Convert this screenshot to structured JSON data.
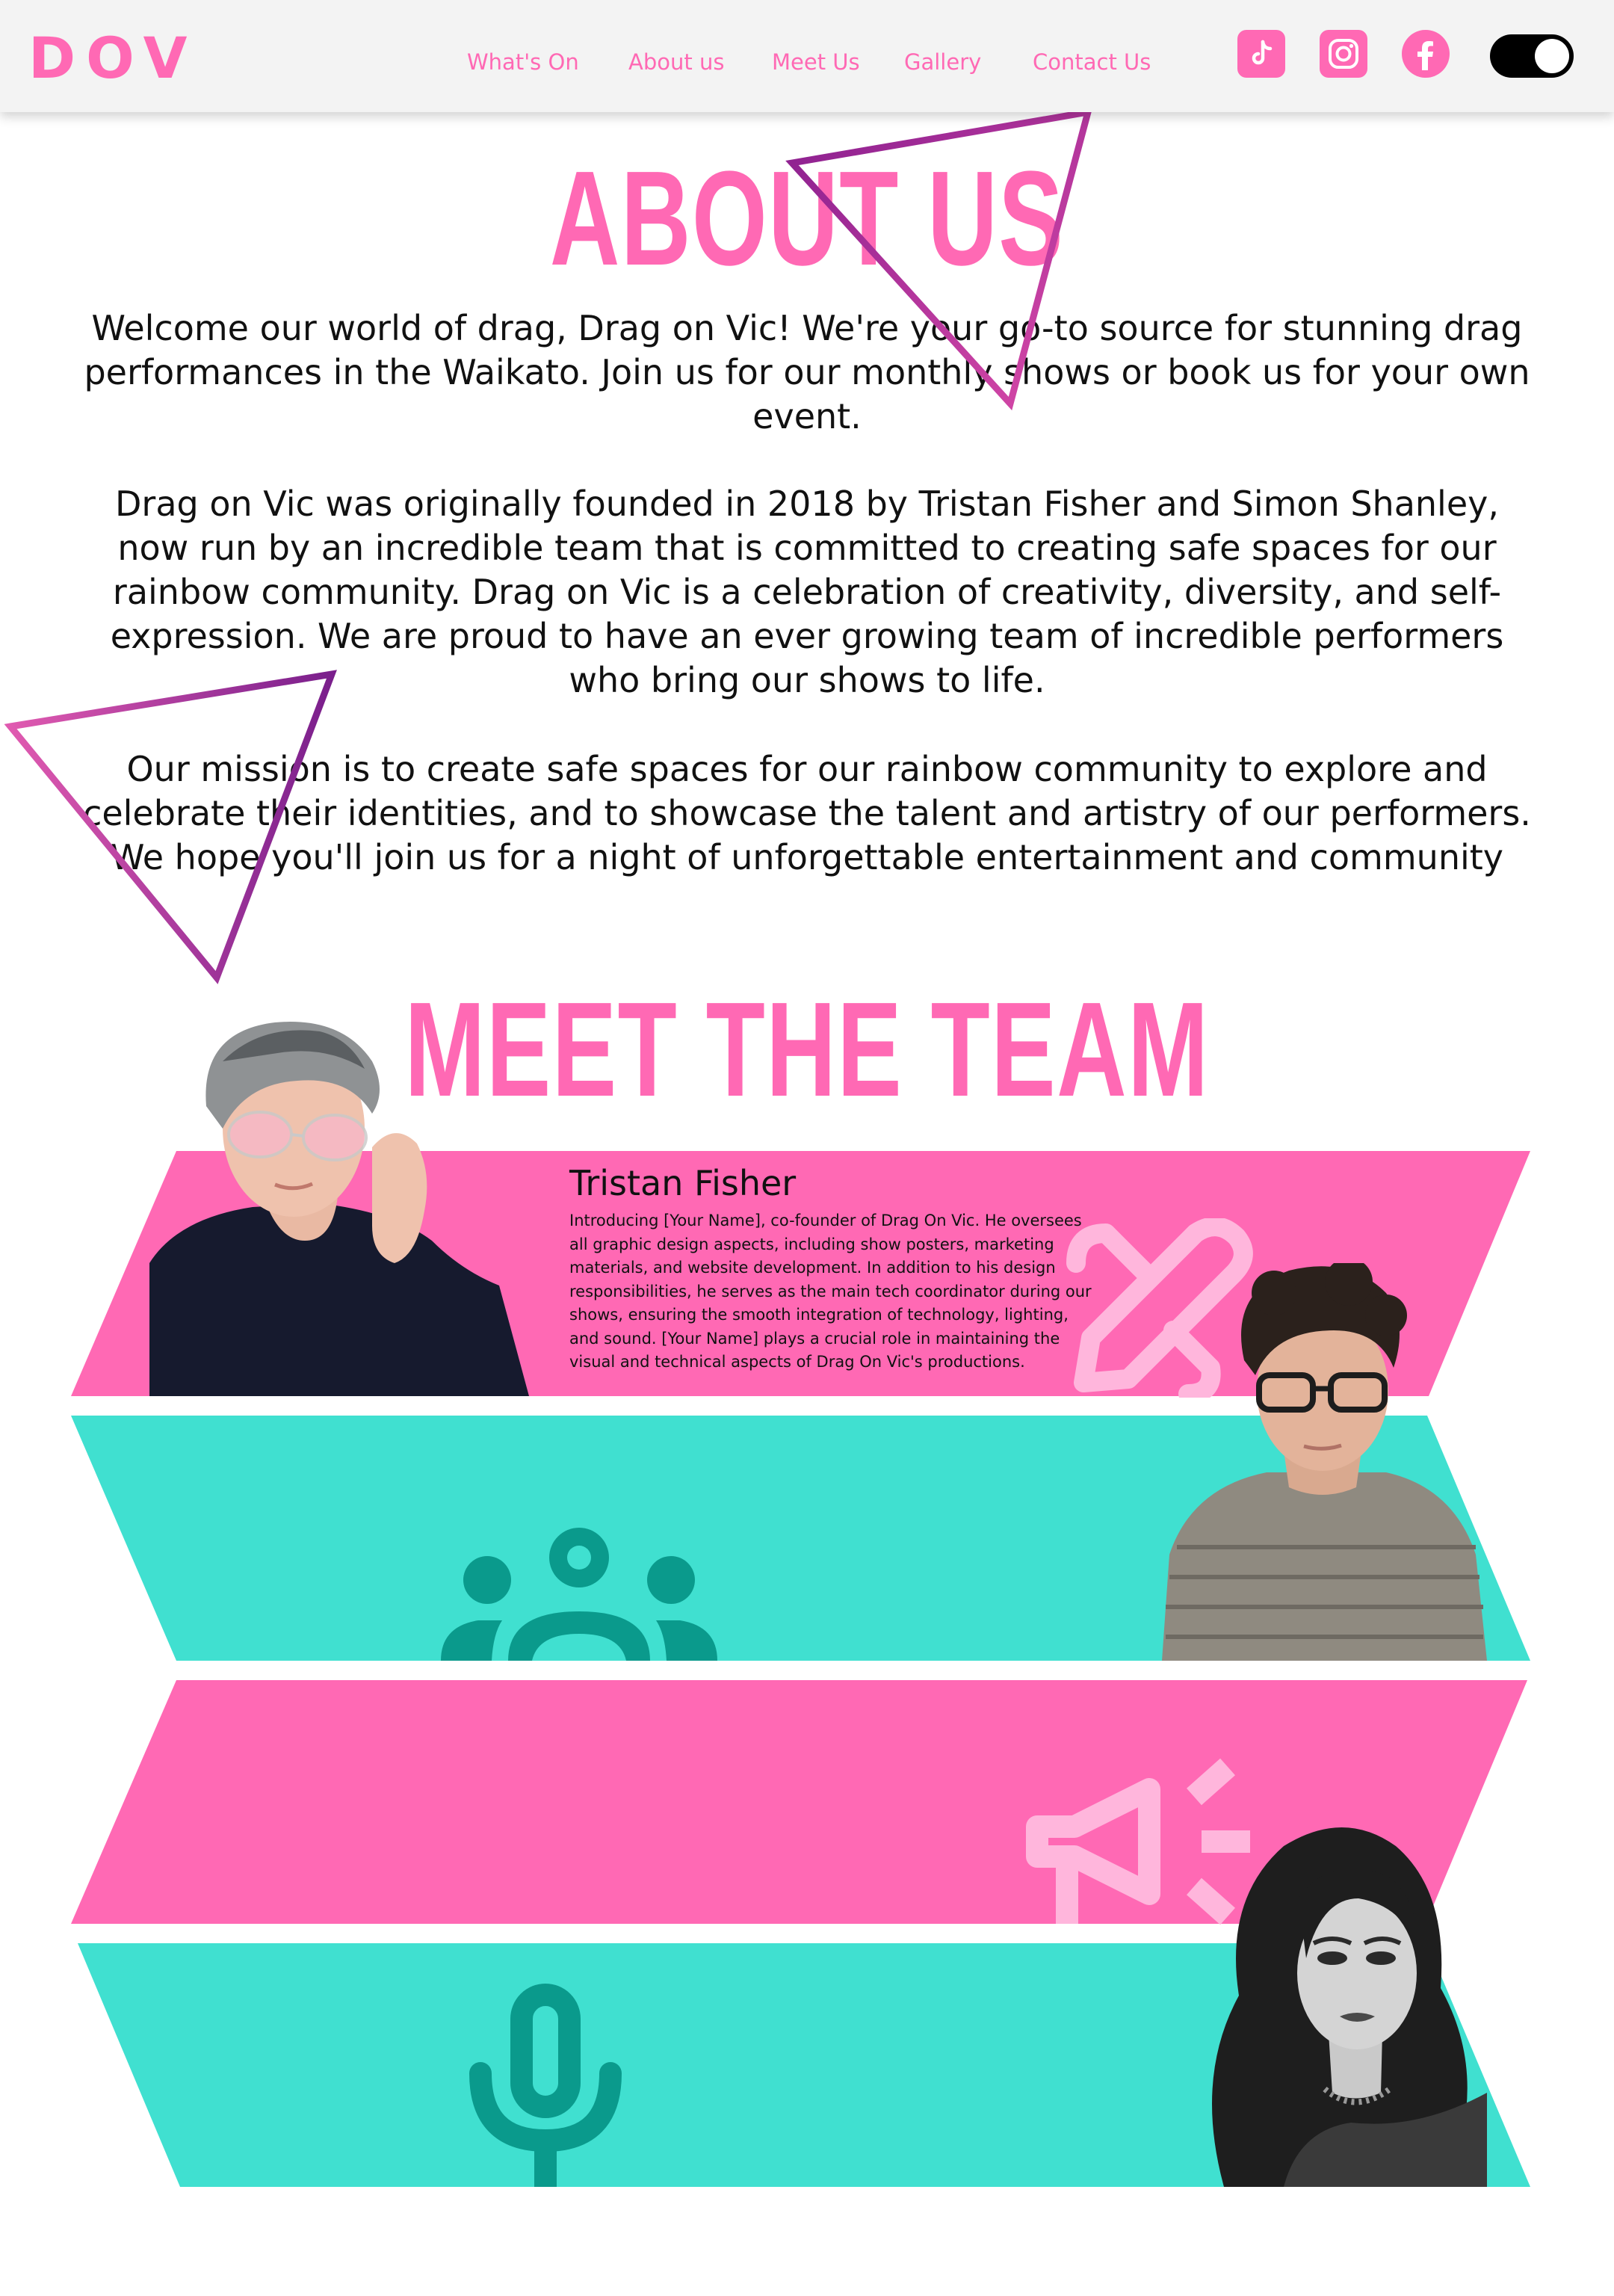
{
  "brand": {
    "logo_text": "DOV"
  },
  "nav": {
    "links": [
      "What's On",
      "About us",
      "Meet Us",
      "Gallery",
      "Contact Us"
    ]
  },
  "social": {
    "icons": [
      "tiktok-icon",
      "instagram-icon",
      "facebook-icon"
    ],
    "theme_toggle_state": "on"
  },
  "about": {
    "heading": "ABOUT US",
    "paragraphs": [
      "Welcome our world of drag, Drag on Vic! We're your go-to source for stunning drag performances in the Waikato. Join us for our monthly shows or book us for your own event.",
      "Drag on Vic was originally founded in 2018 by Tristan Fisher and Simon Shanley, now run by an incredible team that is committed to creating safe spaces for our rainbow community. Drag on Vic is a celebration of creativity, diversity, and self-expression. We are proud to have an ever growing team of incredible performers who bring our shows to life.",
      "Our mission is to create safe spaces for our rainbow community to explore and celebrate their identities, and to showcase the talent and artistry of our performers. We hope you'll join us for a night of unforgettable entertainment and community"
    ]
  },
  "team": {
    "heading": "MEET THE TEAM",
    "members": [
      {
        "name": "Tristan Fisher",
        "bio": "Introducing [Your Name], co-founder of Drag On Vic. He oversees all graphic design aspects, including show posters, marketing materials, and website development. In addition to his design responsibilities, he serves as the main tech coordinator during our shows, ensuring the smooth integration of technology, lighting, and sound. [Your Name] plays a crucial role in maintaining the visual and technical aspects of Drag On Vic's productions.",
        "role_icon": "pencil-icon"
      },
      {
        "name": "",
        "bio": "",
        "role_icon": "group-icon"
      },
      {
        "name": "",
        "bio": "",
        "role_icon": "megaphone-icon"
      },
      {
        "name": "",
        "bio": "",
        "role_icon": "microphone-icon"
      }
    ]
  },
  "colors": {
    "pink": "#ff69b4",
    "light_pink": "#ffb6dc",
    "teal": "#40e0d0",
    "dark_teal": "#0a9a8c",
    "purple": "#7a1f8c",
    "navbar_bg": "#f3f3f3"
  }
}
